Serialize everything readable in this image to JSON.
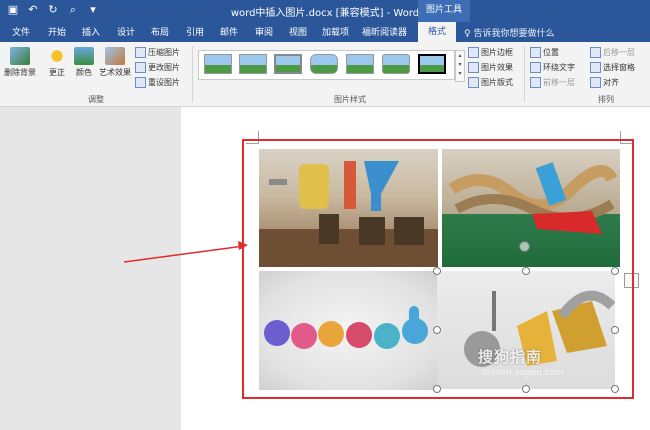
{
  "titlebar": {
    "document_title": "word中插入图片.docx [兼容模式] - Word",
    "context_tab_group": "图片工具"
  },
  "tabs": [
    "文件",
    "开始",
    "插入",
    "设计",
    "布局",
    "引用",
    "邮件",
    "审阅",
    "视图",
    "加载项",
    "福昕阅读器",
    "格式"
  ],
  "active_tab": "格式",
  "tell_me": "告诉我你想要做什么",
  "ribbon": {
    "adjust": {
      "remove_bg": "删除背景",
      "corrections": "更正",
      "color": "颜色",
      "artistic": "艺术效果",
      "compress": "压缩图片",
      "change": "更改图片",
      "reset": "重设图片",
      "label": "调整"
    },
    "styles": {
      "label": "图片样式",
      "border": "图片边框",
      "effects": "图片效果",
      "layout": "图片版式"
    },
    "arrange": {
      "position": "位置",
      "wrap": "环绕文字",
      "forward": "前移一层",
      "backward": "后移一层",
      "selection_pane": "选择窗格",
      "align": "对齐",
      "label": "排列"
    }
  },
  "watermark": {
    "brand": "搜狗指南",
    "url": "zhinan.sogou.com"
  },
  "colors": {
    "title_bar": "#2b579a",
    "highlight_box": "#e22b2b",
    "arrow": "#e22b2b"
  }
}
